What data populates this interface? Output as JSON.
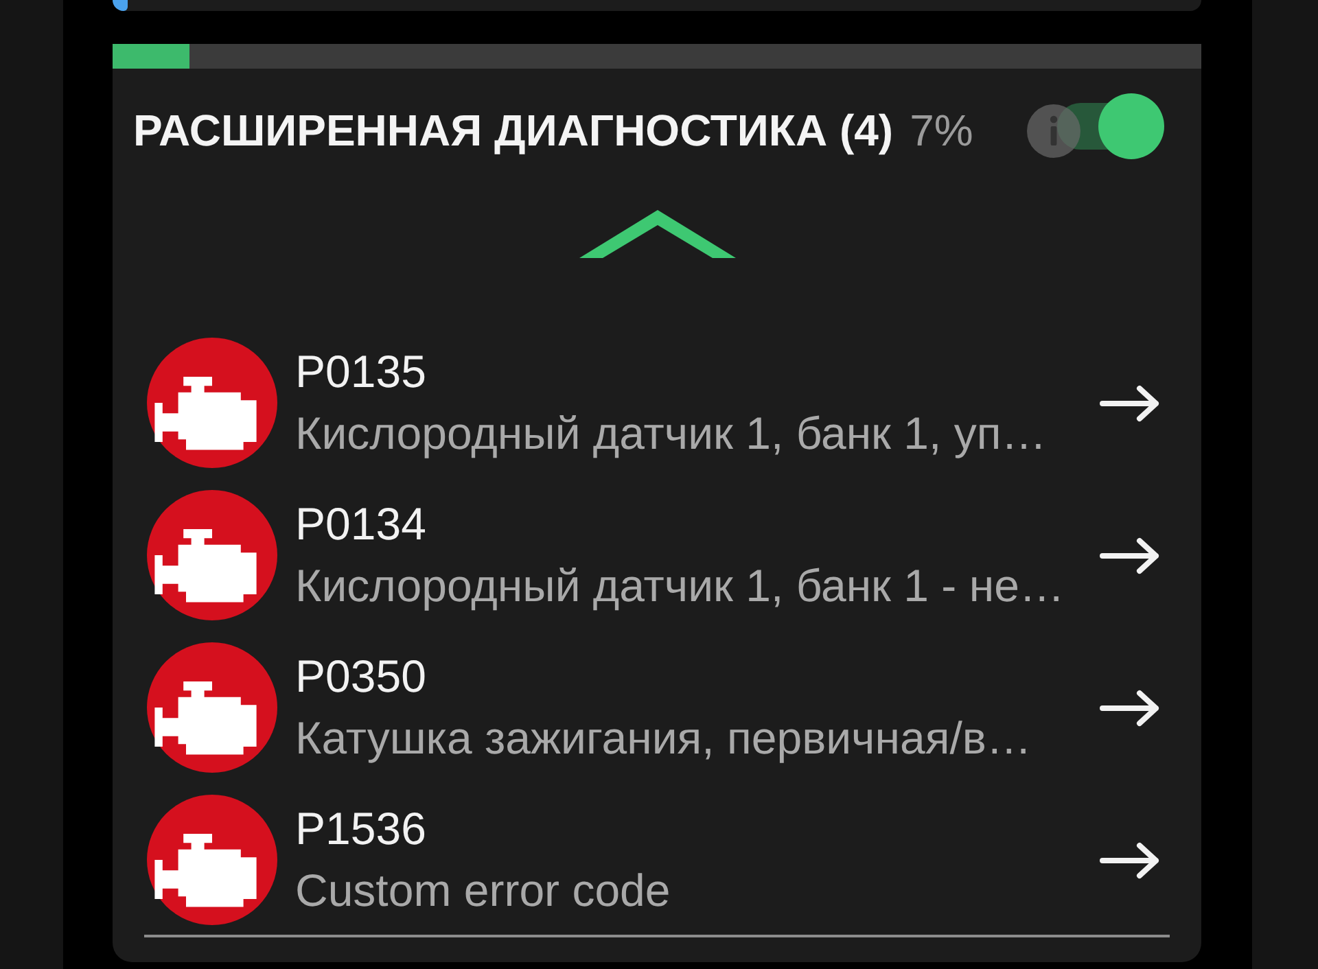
{
  "section": {
    "progress": {
      "level": 0.07
    },
    "title": "РАСШИРЕННАЯ ДИАГНОСТИКА (4)",
    "percent": "7%",
    "toggle": {
      "on": true
    },
    "expanded": true,
    "errors": [
      {
        "code": "P0135",
        "description": "Кислородный датчик 1, банк 1, уп…"
      },
      {
        "code": "P0134",
        "description": "Кислородный датчик 1, банк 1 - не…"
      },
      {
        "code": "P0350",
        "description": "Катушка зажигания, первичная/в…"
      },
      {
        "code": "P1536",
        "description": "Custom error code"
      }
    ]
  }
}
